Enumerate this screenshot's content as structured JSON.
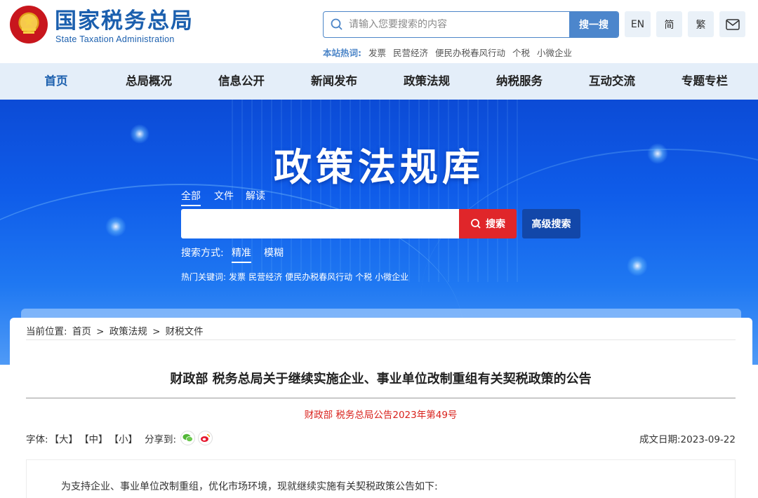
{
  "header": {
    "site_title": "国家税务总局",
    "site_subtitle": "State Taxation Administration",
    "search_placeholder": "请输入您要搜索的内容",
    "search_button": "搜一搜",
    "lang_en": "EN",
    "lang_simplified": "简",
    "lang_traditional": "繁",
    "hot_label": "本站热词:",
    "hot_items": [
      "发票",
      "民营经济",
      "便民办税春风行动",
      "个税",
      "小微企业"
    ]
  },
  "nav": {
    "items": [
      "首页",
      "总局概况",
      "信息公开",
      "新闻发布",
      "政策法规",
      "纳税服务",
      "互动交流",
      "专题专栏"
    ]
  },
  "banner": {
    "title": "政策法规库",
    "tabs": [
      "全部",
      "文件",
      "解读"
    ],
    "search_button": "搜索",
    "advanced_button": "高级搜索",
    "mode_label": "搜索方式:",
    "mode_exact": "精准",
    "mode_fuzzy": "模糊",
    "hot_label": "热门关键词:",
    "hot_items": [
      "发票",
      "民营经济",
      "便民办税春风行动",
      "个税",
      "小微企业"
    ]
  },
  "breadcrumb": {
    "label": "当前位置:",
    "items": [
      "首页",
      ">",
      "政策法规",
      ">",
      "财税文件"
    ]
  },
  "article": {
    "title": "财政部 税务总局关于继续实施企业、事业单位改制重组有关契税政策的公告",
    "doc_number": "财政部 税务总局公告2023年第49号",
    "font_label": "字体:",
    "font_large": "【大】",
    "font_medium": "【中】",
    "font_small": "【小】",
    "share_label": "分享到:",
    "date_label": "成文日期:",
    "date_value": "2023-09-22",
    "body_first_line": "为支持企业、事业单位改制重组，优化市场环境，现就继续实施有关契税政策公告如下:"
  },
  "colors": {
    "brand_blue": "#1b5fae",
    "nav_bg": "#e4eef9",
    "search_red": "#e0262a",
    "advanced_blue": "#1247a9",
    "doc_number_red": "#d9221c"
  }
}
